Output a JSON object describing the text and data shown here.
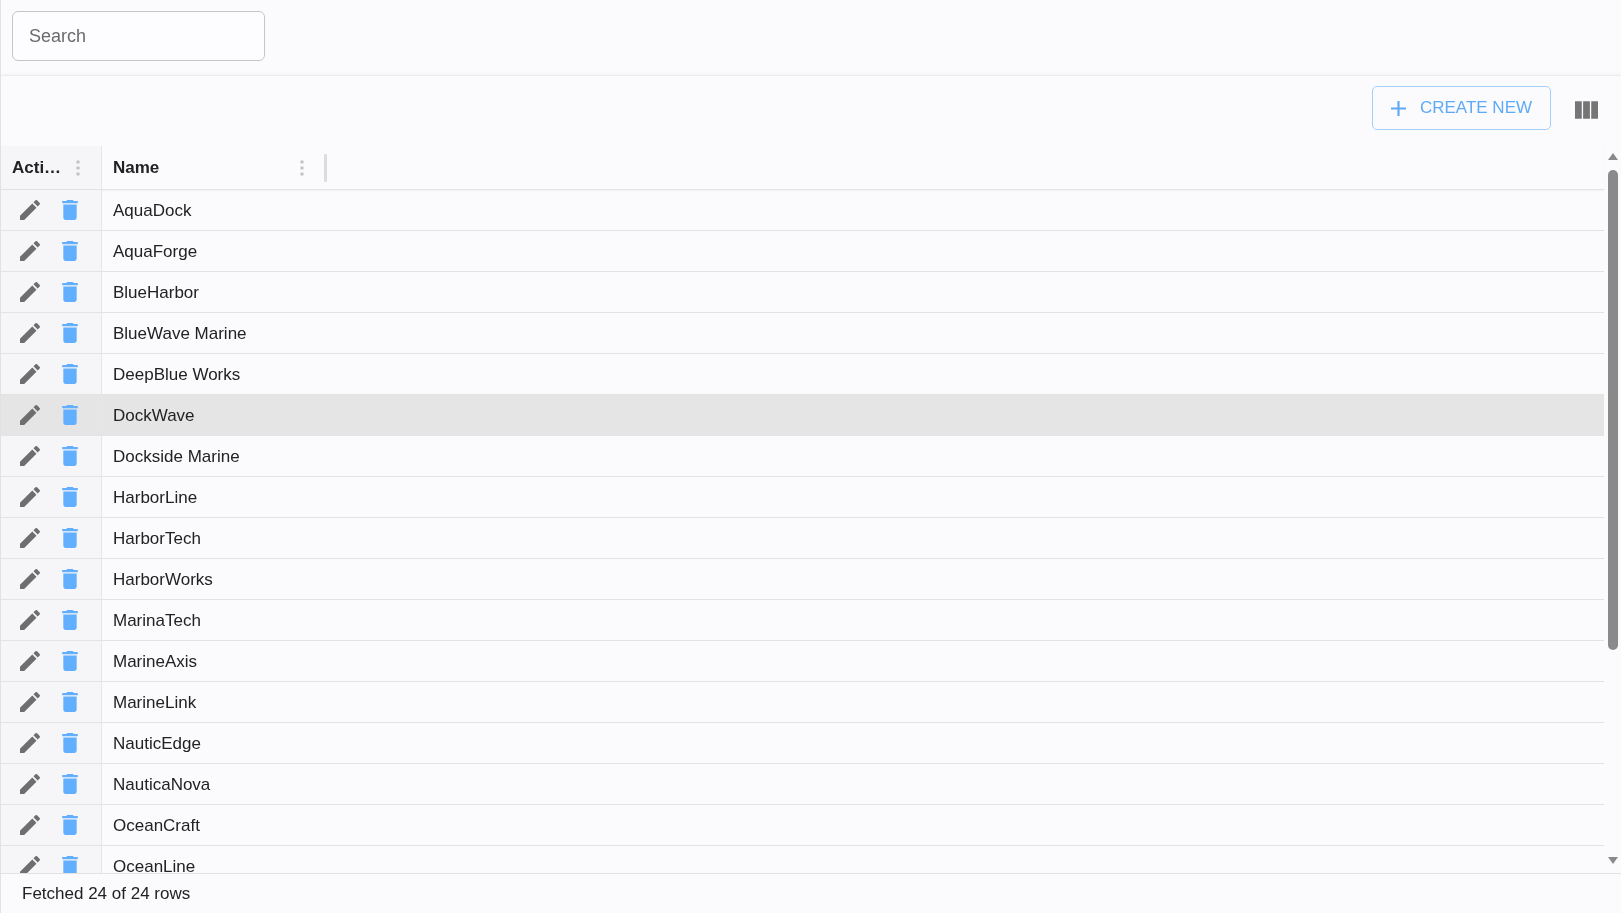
{
  "search": {
    "placeholder": "Search"
  },
  "toolbar": {
    "create_button": "CREATE NEW"
  },
  "table": {
    "columns": [
      {
        "kind": "actions",
        "label": "Acti…"
      },
      {
        "kind": "text",
        "label": "Name"
      }
    ],
    "rows": [
      {
        "name": "AquaDock",
        "selected": false
      },
      {
        "name": "AquaForge",
        "selected": false
      },
      {
        "name": "BlueHarbor",
        "selected": false
      },
      {
        "name": "BlueWave Marine",
        "selected": false
      },
      {
        "name": "DeepBlue Works",
        "selected": false
      },
      {
        "name": "DockWave",
        "selected": true
      },
      {
        "name": "Dockside Marine",
        "selected": false
      },
      {
        "name": "HarborLine",
        "selected": false
      },
      {
        "name": "HarborTech",
        "selected": false
      },
      {
        "name": "HarborWorks",
        "selected": false
      },
      {
        "name": "MarinaTech",
        "selected": false
      },
      {
        "name": "MarineAxis",
        "selected": false
      },
      {
        "name": "MarineLink",
        "selected": false
      },
      {
        "name": "NauticEdge",
        "selected": false
      },
      {
        "name": "NauticaNova",
        "selected": false
      },
      {
        "name": "OceanCraft",
        "selected": false
      },
      {
        "name": "OceanLine",
        "selected": false
      }
    ]
  },
  "status_bar": "Fetched 24 of 24 rows"
}
